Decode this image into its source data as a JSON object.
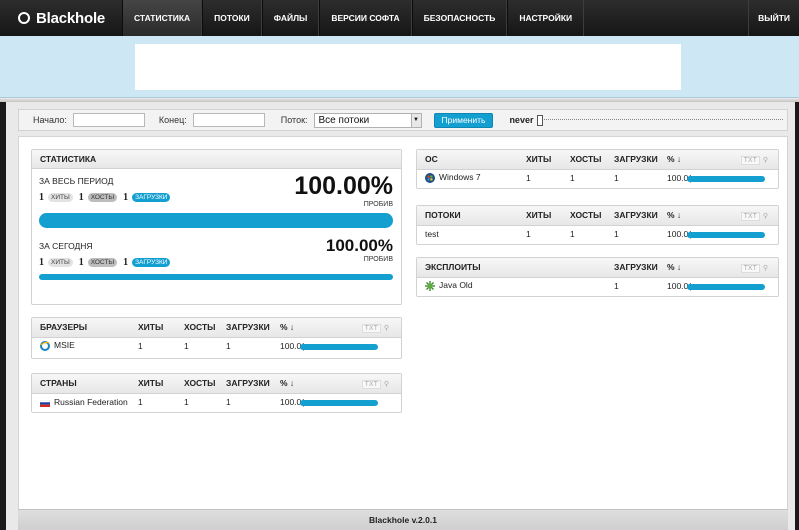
{
  "header": {
    "logo": "Blackhole",
    "nav": [
      {
        "label": "СТАТИСТИКА",
        "active": true
      },
      {
        "label": "ПОТОКИ"
      },
      {
        "label": "ФАЙЛЫ"
      },
      {
        "label": "ВЕРСИИ СОФТА"
      },
      {
        "label": "БЕЗОПАСНОСТЬ"
      },
      {
        "label": "НАСТРОЙКИ"
      }
    ],
    "logout": "ВЫЙТИ"
  },
  "filter": {
    "start_label": "Начало:",
    "start_value": "",
    "end_label": "Конец:",
    "end_value": "",
    "stream_label": "Поток:",
    "stream_value": "Все потоки",
    "apply": "Применить",
    "never": "never"
  },
  "stats": {
    "title": "СТАТИСТИКА",
    "all_time": {
      "label": "ЗА ВЕСЬ ПЕРИОД",
      "hits": "1",
      "hits_label": "ХИТЫ",
      "hosts": "1",
      "hosts_label": "ХОСТЫ",
      "loads": "1",
      "loads_label": "ЗАГРУЗКИ",
      "percent": "100.00%",
      "probiv": "ПРОБИВ"
    },
    "today": {
      "label": "ЗА СЕГОДНЯ",
      "hits": "1",
      "hits_label": "ХИТЫ",
      "hosts": "1",
      "hosts_label": "ХОСТЫ",
      "loads": "1",
      "loads_label": "ЗАГРУЗКИ",
      "percent": "100.00%",
      "probiv": "ПРОБИВ"
    }
  },
  "browsers": {
    "headers": [
      "БРАУЗЕРЫ",
      "ХИТЫ",
      "ХОСТЫ",
      "ЗАГРУЗКИ",
      "% ↓"
    ],
    "txt": "TXT",
    "rows": [
      {
        "name": "MSIE",
        "hits": "1",
        "hosts": "1",
        "loads": "1",
        "pct": "100.0("
      }
    ]
  },
  "countries": {
    "headers": [
      "СТРАНЫ",
      "ХИТЫ",
      "ХОСТЫ",
      "ЗАГРУЗКИ",
      "% ↓"
    ],
    "txt": "TXT",
    "rows": [
      {
        "name": "Russian Federation",
        "hits": "1",
        "hosts": "1",
        "loads": "1",
        "pct": "100.0("
      }
    ]
  },
  "os": {
    "headers": [
      "ОС",
      "ХИТЫ",
      "ХОСТЫ",
      "ЗАГРУЗКИ",
      "% ↓"
    ],
    "txt": "TXT",
    "rows": [
      {
        "name": "Windows 7",
        "hits": "1",
        "hosts": "1",
        "loads": "1",
        "pct": "100.0("
      }
    ]
  },
  "streams": {
    "headers": [
      "ПОТОКИ",
      "ХИТЫ",
      "ХОСТЫ",
      "ЗАГРУЗКИ",
      "% ↓"
    ],
    "txt": "TXT",
    "rows": [
      {
        "name": "test",
        "hits": "1",
        "hosts": "1",
        "loads": "1",
        "pct": "100.0("
      }
    ]
  },
  "exploits": {
    "headers": [
      "ЭКСПЛОИТЫ",
      "ЗАГРУЗКИ",
      "% ↓"
    ],
    "txt": "TXT",
    "rows": [
      {
        "name": "Java Old",
        "loads": "1",
        "pct": "100.0("
      }
    ]
  },
  "footer": "Blackhole v.2.0.1",
  "colors": {
    "accent": "#149fd1",
    "topbar": "#1e1e1e",
    "banner": "#cde8f4"
  }
}
